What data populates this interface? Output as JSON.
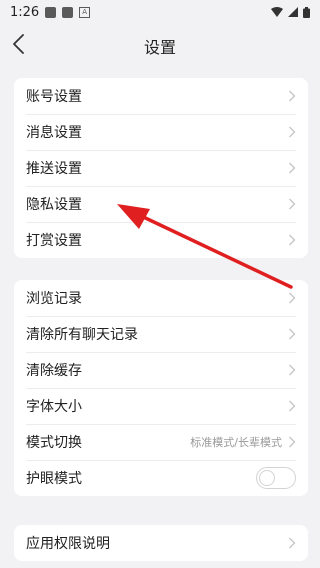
{
  "status_bar": {
    "time": "1:26"
  },
  "header": {
    "title": "设置"
  },
  "group1": [
    {
      "label": "账号设置"
    },
    {
      "label": "消息设置"
    },
    {
      "label": "推送设置"
    },
    {
      "label": "隐私设置"
    },
    {
      "label": "打赏设置"
    }
  ],
  "group2": [
    {
      "label": "浏览记录"
    },
    {
      "label": "清除所有聊天记录"
    },
    {
      "label": "清除缓存"
    },
    {
      "label": "字体大小"
    },
    {
      "label": "模式切换",
      "value": "标准模式/长辈模式"
    },
    {
      "label": "护眼模式",
      "toggle": false
    }
  ],
  "group3": [
    {
      "label": "应用权限说明"
    }
  ],
  "colors": {
    "annotation_arrow": "#e02020",
    "background": "#f2f2f4"
  }
}
